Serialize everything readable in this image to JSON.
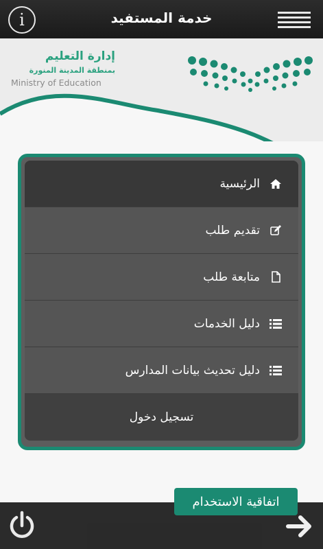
{
  "topbar": {
    "title": "خدمة المستفيد",
    "info_glyph": "i"
  },
  "logo": {
    "arabic_line_1": "إدارة التعليم",
    "arabic_line_2": "بمنطقة المدينة المنورة",
    "english": "Ministry of Education"
  },
  "menu": {
    "items": [
      {
        "label": "الرئيسية",
        "icon": "home-icon"
      },
      {
        "label": "تقديم طلب",
        "icon": "edit-icon"
      },
      {
        "label": "متابعة طلب",
        "icon": "document-icon"
      },
      {
        "label": "دليل الخدمات",
        "icon": "list-icon"
      },
      {
        "label": "دليل تحديث بيانات المدارس",
        "icon": "list-icon"
      }
    ],
    "login_label": "تسجيل دخول"
  },
  "agreement_label": "اتفاقية الاستخدام",
  "colors": {
    "accent": "#1b8a72",
    "logo_green": "#2aa17f",
    "menu_bg": "#555555",
    "menu_active": "#383838",
    "topbar": "#222222"
  }
}
